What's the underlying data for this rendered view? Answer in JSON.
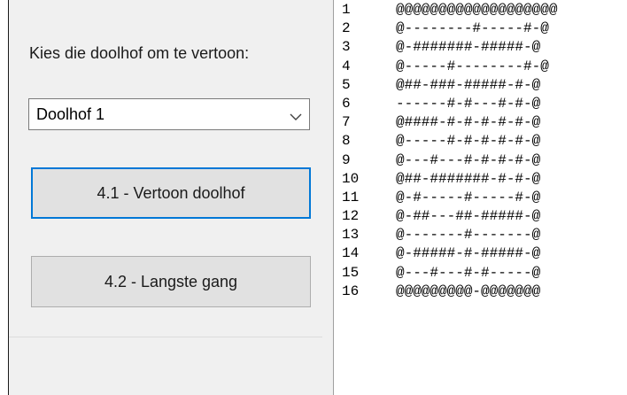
{
  "controls": {
    "maze_label": "Kies die doolhof om te vertoon:",
    "maze_select": {
      "selected": "Doolhof 1",
      "icon": "chevron-down-icon"
    },
    "show_maze_button": "4.1 - Vertoon doolhof",
    "longest_path_button": "4.2 - Langste gang",
    "focus_color": "#0078d7"
  },
  "maze_output": {
    "rows": [
      {
        "num": "1",
        "text": "@@@@@@@@@@@@@@@@@@@"
      },
      {
        "num": "2",
        "text": "@--------#-----#-@"
      },
      {
        "num": "3",
        "text": "@-#######-#####-@"
      },
      {
        "num": "4",
        "text": "@-----#--------#-@"
      },
      {
        "num": "5",
        "text": "@##-###-#####-#-@"
      },
      {
        "num": "6",
        "text": "------#-#---#-#-@"
      },
      {
        "num": "7",
        "text": "@####-#-#-#-#-#-@"
      },
      {
        "num": "8",
        "text": "@-----#-#-#-#-#-@"
      },
      {
        "num": "9",
        "text": "@---#---#-#-#-#-@"
      },
      {
        "num": "10",
        "text": "@##-#######-#-#-@"
      },
      {
        "num": "11",
        "text": "@-#-----#-----#-@"
      },
      {
        "num": "12",
        "text": "@-##---##-#####-@"
      },
      {
        "num": "13",
        "text": "@-------#-------@"
      },
      {
        "num": "14",
        "text": "@-#####-#-#####-@"
      },
      {
        "num": "15",
        "text": "@---#---#-#-----@"
      },
      {
        "num": "16",
        "text": "@@@@@@@@@-@@@@@@@"
      }
    ]
  }
}
